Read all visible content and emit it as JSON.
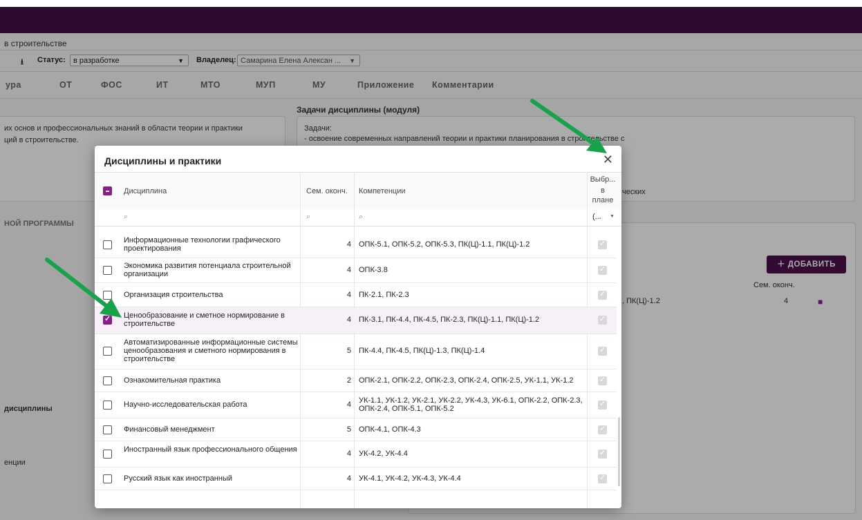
{
  "breadcrumb": "в строительстве",
  "toolbar": {
    "status_label": "Статус:",
    "status_value": "в разработке",
    "owner_label": "Владелец:",
    "owner_value": "Самарина Елена Алексан ..."
  },
  "tabs": [
    "ура",
    "ОТ",
    "ФОС",
    "ИТ",
    "МТО",
    "МУП",
    "МУ",
    "Приложение",
    "Комментарии"
  ],
  "background": {
    "tasks_title": "Задачи дисциплины (модуля)",
    "left_text_1": "их основ и профессиональных знаний в области теории и практики",
    "left_text_2": "ций в строительстве.",
    "tasks_text_1": "Задачи:",
    "tasks_text_2": "- освоение современных направлений теории и практики планирования в строительстве с",
    "tasks_text_3": "ческих",
    "program_label": "НОЙ ПРОГРАММЫ",
    "add_button": "ДОБАВИТЬ",
    "table_header_sem": "Сем. оконч.",
    "table_row_comp": ", ПК(Ц)-1.2",
    "table_row_sem": "4",
    "disc_label": "дисциплины",
    "comp_label": "енции"
  },
  "modal": {
    "title": "Дисциплины и практики",
    "columns": {
      "discipline": "Дисциплина",
      "sem": "Сем. оконч.",
      "competencies": "Компетенции",
      "in_plan_1": "Выбр...",
      "in_plan_2": "в",
      "in_plan_3": "плане"
    },
    "filter_select": "(...",
    "rows": [
      {
        "name": "Информационные технологии графического проектирования",
        "sem": "4",
        "comp": "ОПК-5.1, ОПК-5.2, ОПК-5.3, ПК(Ц)-1.1, ПК(Ц)-1.2",
        "checked": false
      },
      {
        "name": "Экономика развития потенциала строительной организации",
        "sem": "4",
        "comp": "ОПК-3.8",
        "checked": false
      },
      {
        "name": "Организация строительства",
        "sem": "4",
        "comp": "ПК-2.1, ПК-2.3",
        "checked": false
      },
      {
        "name": "Ценообразование и сметное нормирование в строительстве",
        "sem": "4",
        "comp": "ПК-3.1, ПК-4.4, ПК-4.5, ПК-2.3, ПК(Ц)-1.1, ПК(Ц)-1.2",
        "checked": true
      },
      {
        "name": "Автоматизированные информационные системы ценообразования и сметного нормирования в строительстве",
        "sem": "5",
        "comp": "ПК-4.4, ПК-4.5, ПК(Ц)-1.3, ПК(Ц)-1.4",
        "checked": false
      },
      {
        "name": "Ознакомительная практика",
        "sem": "2",
        "comp": "ОПК-2.1, ОПК-2.2, ОПК-2.3, ОПК-2.4, ОПК-2.5, УК-1.1, УК-1.2",
        "checked": false
      },
      {
        "name": "Научно-исследовательская работа",
        "sem": "4",
        "comp": "УК-1.1, УК-1.2, УК-2.1, УК-2.2, УК-4.3, УК-6.1, ОПК-2.2, ОПК-2.3, ОПК-2.4, ОПК-5.1, ОПК-5.2",
        "checked": false
      },
      {
        "name": "Финансовый менеджмент",
        "sem": "5",
        "comp": "ОПК-4.1, ОПК-4.3",
        "checked": false
      },
      {
        "name": "Иностранный язык профессионального общения",
        "sem": "4",
        "comp": "УК-4.2, УК-4.4",
        "checked": false
      },
      {
        "name": "Русский язык как иностранный",
        "sem": "4",
        "comp": "УК-4.1, УК-4.2, УК-4.3, УК-4.4",
        "checked": false
      }
    ]
  },
  "colors": {
    "accent": "#8e1b8c",
    "header": "#2d0a2f",
    "arrow": "#17a34a"
  }
}
